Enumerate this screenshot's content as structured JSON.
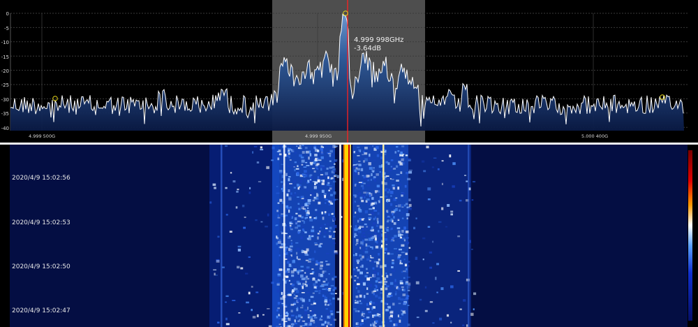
{
  "spectrum": {
    "y_ticks": [
      "0",
      "-5",
      "-10",
      "-15",
      "-20",
      "-25",
      "-30",
      "-35",
      "-40"
    ],
    "freq_labels": [
      "4.999 500G",
      "4.999 950G",
      "5.000 400G"
    ],
    "marker": {
      "freq": "4.999 998GHz",
      "level": "-3.64dB"
    },
    "colors": {
      "fill_top": "#3d6fb0",
      "fill_bottom": "#0a1a45",
      "trace": "#ffffff",
      "marker": "#e8d81a",
      "cursor": "#ff2020"
    }
  },
  "waterfall": {
    "timestamps": [
      "2020/4/9 15:02:56",
      "2020/4/9 15:02:53",
      "2020/4/9 15:02:50",
      "2020/4/9 15:02:47"
    ],
    "colors": {
      "background": "#030820",
      "carrier": "#ffdd00",
      "hot": "#c00000"
    }
  }
}
